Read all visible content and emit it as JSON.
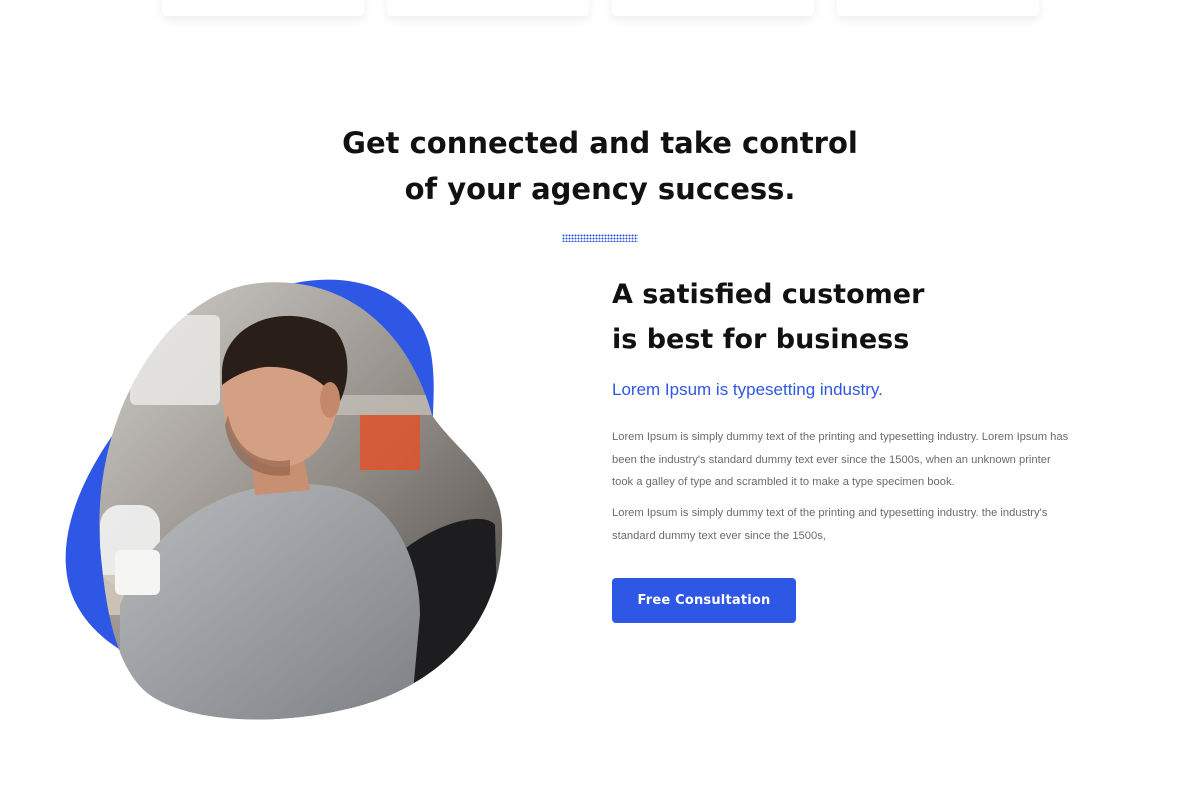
{
  "colors": {
    "accent": "#2e57e6",
    "heading": "#111111",
    "body_text": "#6b6b6b",
    "background": "#ffffff"
  },
  "section": {
    "title_line1": "Get connected and take control",
    "title_line2": "of your agency success."
  },
  "feature": {
    "title_line1": "A satisfied customer",
    "title_line2": "is best for business",
    "subtitle": "Lorem Ipsum is typesetting industry.",
    "paragraph1": "Lorem Ipsum is simply dummy text of the printing and typesetting industry. Lorem Ipsum has been the industry's standard dummy text ever since the 1500s, when an unknown printer took a galley of type and scrambled it to make a type specimen book.",
    "paragraph2": "Lorem Ipsum is simply dummy text of the printing and typesetting industry. the industry's standard dummy text ever since the 1500s,",
    "cta_label": "Free Consultation"
  },
  "image": {
    "subject": "man working at desk photo in blob shape",
    "decoration": "blue-blob-shape"
  }
}
